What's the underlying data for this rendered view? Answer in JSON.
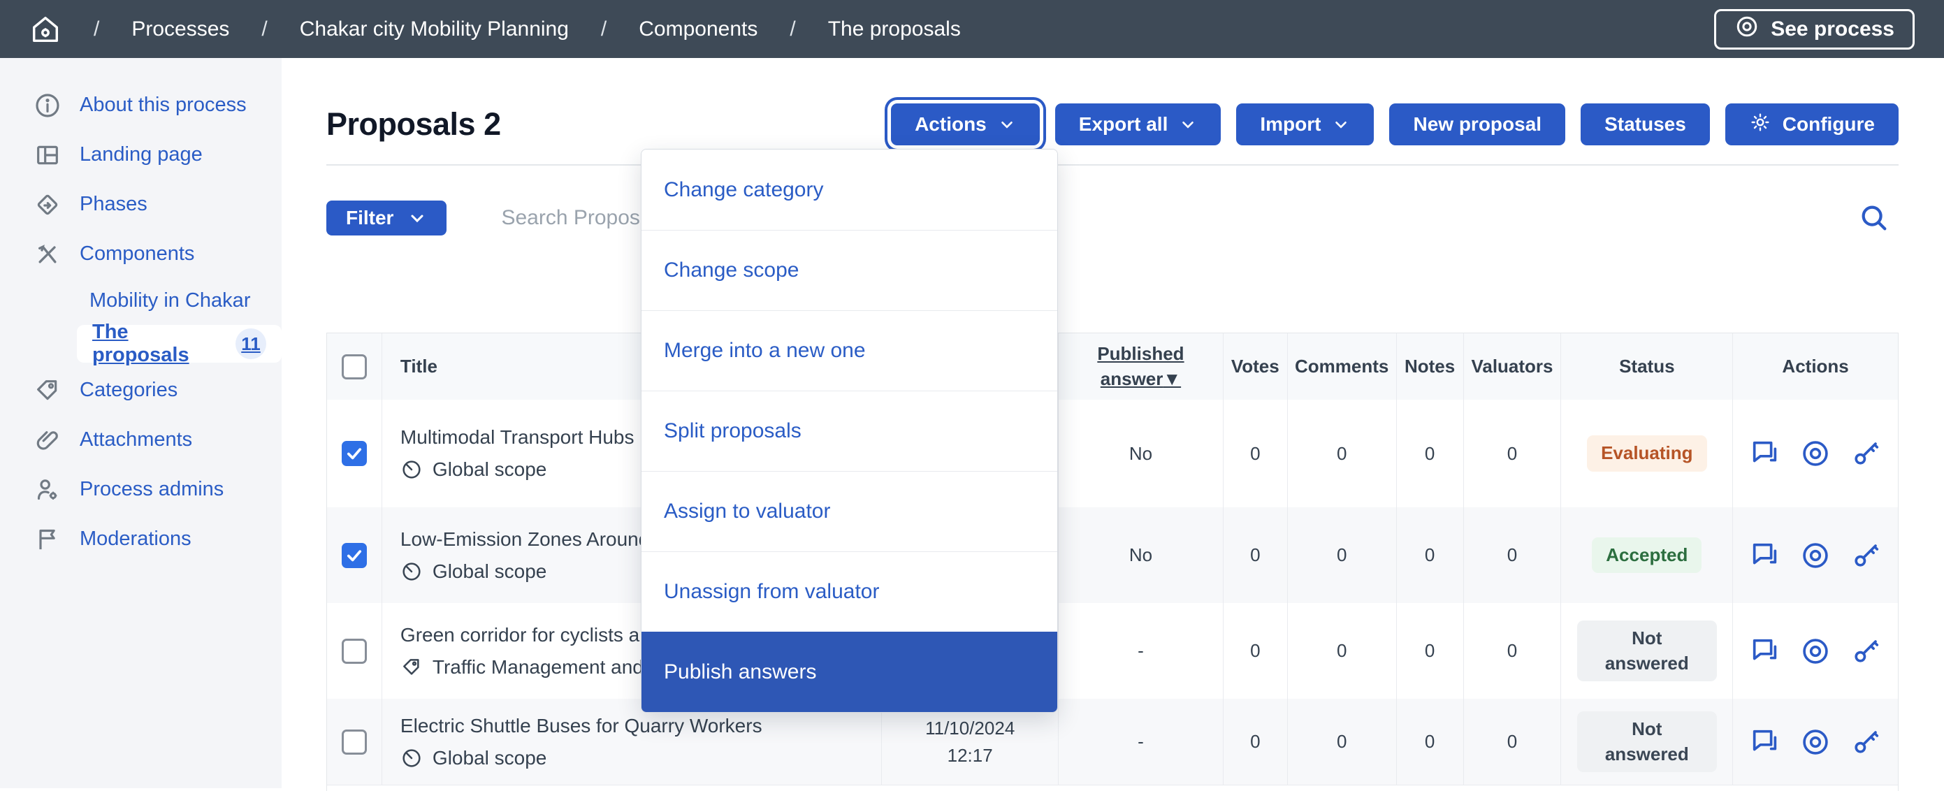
{
  "topbar": {
    "breadcrumb": [
      "Processes",
      "Chakar city Mobility Planning",
      "Components",
      "The proposals"
    ],
    "separator": "/",
    "see_process_label": "See process"
  },
  "sidebar": {
    "items": [
      {
        "label": "About this process",
        "icon": "info-circle-icon"
      },
      {
        "label": "Landing page",
        "icon": "layout-grid-icon"
      },
      {
        "label": "Phases",
        "icon": "phases-diamond-icon"
      },
      {
        "label": "Components",
        "icon": "tools-icon"
      },
      {
        "label": "Mobility in Chakar",
        "icon": null
      },
      {
        "label": "The proposals",
        "icon": null,
        "badge": "11",
        "active": true
      },
      {
        "label": "Categories",
        "icon": "tag-icon"
      },
      {
        "label": "Attachments",
        "icon": "paperclip-icon"
      },
      {
        "label": "Process admins",
        "icon": "user-gear-icon"
      },
      {
        "label": "Moderations",
        "icon": "flag-icon"
      }
    ]
  },
  "page": {
    "title": "Proposals 2"
  },
  "toolbar": {
    "actions": "Actions",
    "export_all": "Export all",
    "import": "Import",
    "new_proposal": "New proposal",
    "statuses": "Statuses",
    "configure": "Configure"
  },
  "actions_menu": {
    "items": [
      "Change category",
      "Change scope",
      "Merge into a new one",
      "Split proposals",
      "Assign to valuator",
      "Unassign from valuator",
      "Publish answers"
    ],
    "highlighted_item": "Publish answers"
  },
  "filters": {
    "filter_label": "Filter",
    "search_placeholder": "Search Proposals"
  },
  "table": {
    "headers": {
      "title": "Title",
      "published_l1": "Published",
      "published_l2": "answer",
      "sort_indicator": "▼",
      "votes": "Votes",
      "comments": "Comments",
      "notes": "Notes",
      "valuators": "Valuators",
      "status": "Status",
      "actions": "Actions"
    },
    "rows": [
      {
        "checked": true,
        "title": "Multimodal Transport Hubs",
        "scope": "Global scope",
        "scope_icon": "forbid-circle-icon",
        "published_answer": "No",
        "votes": "0",
        "comments": "0",
        "notes": "0",
        "valuators": "0",
        "status": "Evaluating"
      },
      {
        "checked": true,
        "title": "Low-Emission Zones Around I",
        "scope": "Global scope",
        "scope_icon": "forbid-circle-icon",
        "published_answer": "No",
        "votes": "0",
        "comments": "0",
        "notes": "0",
        "valuators": "0",
        "status": "Accepted"
      },
      {
        "checked": false,
        "title": "Green corridor for cyclists and",
        "scope": "Traffic Management and S",
        "scope_icon": "tag-icon",
        "published_answer": "-",
        "votes": "0",
        "comments": "0",
        "notes": "0",
        "valuators": "0",
        "status": "Not answered"
      },
      {
        "checked": false,
        "title": "Electric Shuttle Buses for Quarry Workers",
        "scope": "Global scope",
        "scope_icon": "forbid-circle-icon",
        "date_line1": "11/10/2024",
        "date_line2": "12:17",
        "published_answer": "-",
        "votes": "0",
        "comments": "0",
        "notes": "0",
        "valuators": "0",
        "status": "Not answered"
      }
    ],
    "row_action_icons": [
      "answer-chat-icon",
      "preview-eye-icon",
      "permissions-key-icon"
    ]
  },
  "colors": {
    "topbar_bg": "#3e4a57",
    "accent_blue": "#2b5ac6",
    "link_blue": "#2a5cc5",
    "checkbox_blue": "#2e6fe6",
    "menu_highlight": "#2e57b5",
    "status_evaluating_text": "#b65426",
    "status_evaluating_bg": "#fdf1e6",
    "status_accepted_text": "#2c6e3f",
    "status_accepted_bg": "#e9f6ec",
    "status_notanswered_text": "#3a4654",
    "status_notanswered_bg": "#eff1f3",
    "sidebar_bg": "#f4f5f8"
  }
}
